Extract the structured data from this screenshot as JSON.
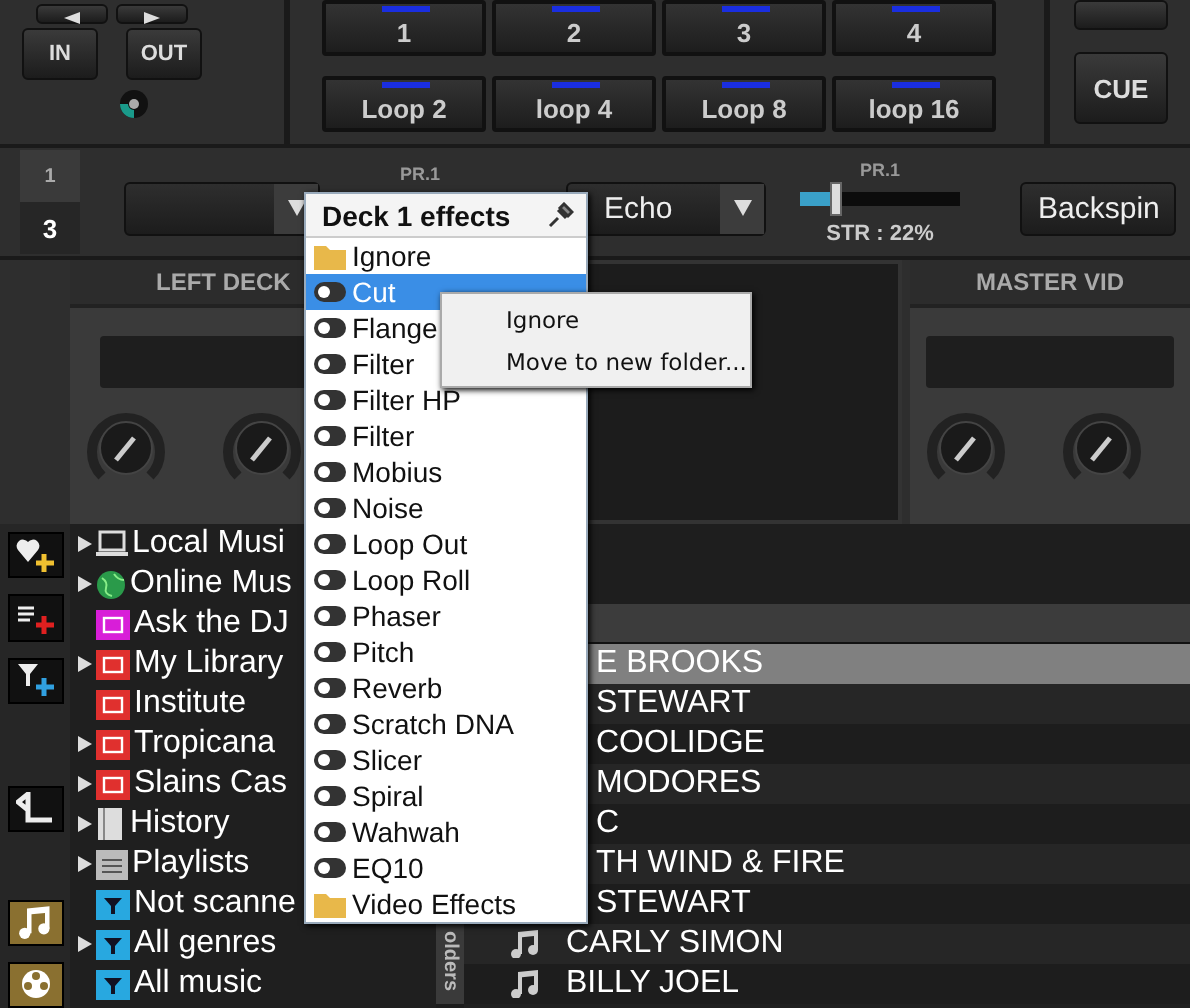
{
  "top": {
    "buttons": [
      "IN",
      "OUT"
    ],
    "pads": [
      {
        "label": "1"
      },
      {
        "label": "2"
      },
      {
        "label": "3"
      },
      {
        "label": "4"
      },
      {
        "label": "Loop 2"
      },
      {
        "label": "loop 4"
      },
      {
        "label": "Loop 8"
      },
      {
        "label": "loop 16"
      }
    ],
    "cue": "CUE"
  },
  "effects_row": {
    "decks": [
      {
        "label": "1",
        "selected": false
      },
      {
        "label": "3",
        "selected": true
      }
    ],
    "slots": [
      {
        "label": "PR.1"
      },
      {
        "label": "PR.1"
      }
    ],
    "echo": "Echo",
    "strength": {
      "level": 0.22,
      "reading": "STR : 22%"
    },
    "backspin": "Backspin"
  },
  "panels": [
    {
      "title": "LEFT DECK"
    },
    {
      "title": "MASTER VID"
    }
  ],
  "sidebar_tree": [
    {
      "label": "Local Musi",
      "kind": "computer",
      "expandable": true
    },
    {
      "label": "Online Mus",
      "kind": "globe",
      "expandable": true
    },
    {
      "label": "Ask the DJ",
      "kind": "folder",
      "color": "#d81ed8",
      "expandable": false
    },
    {
      "label": "My Library",
      "kind": "folder",
      "color": "#e0302e",
      "expandable": true
    },
    {
      "label": "Institute",
      "kind": "folder",
      "color": "#e0302e",
      "expandable": false
    },
    {
      "label": "Tropicana",
      "kind": "folder",
      "color": "#e0302e",
      "expandable": true
    },
    {
      "label": "Slains Cas",
      "kind": "folder",
      "color": "#e0302e",
      "expandable": true
    },
    {
      "label": "History",
      "kind": "history",
      "expandable": true
    },
    {
      "label": "Playlists",
      "kind": "playlist",
      "expandable": true
    },
    {
      "label": "Not scanne",
      "kind": "filter",
      "color": "#28a8e0",
      "expandable": false
    },
    {
      "label": "All genres",
      "kind": "filter",
      "color": "#28a8e0",
      "expandable": true
    },
    {
      "label": "All music",
      "kind": "filter",
      "color": "#28a8e0",
      "expandable": false
    }
  ],
  "folders_tab": "olders",
  "tracks": [
    {
      "artist": "E BROOKS",
      "selected": true,
      "note_icon": false
    },
    {
      "artist": "STEWART",
      "selected": false,
      "note_icon": false
    },
    {
      "artist": "COOLIDGE",
      "selected": false,
      "note_icon": false
    },
    {
      "artist": "MODORES",
      "selected": false,
      "note_icon": false
    },
    {
      "artist": "C",
      "selected": false,
      "note_icon": false
    },
    {
      "artist": "TH WIND & FIRE",
      "selected": false,
      "note_icon": false
    },
    {
      "artist": "STEWART",
      "selected": false,
      "note_icon": false
    },
    {
      "artist": "CARLY SIMON",
      "selected": false,
      "note_icon": true
    },
    {
      "artist": "BILLY JOEL",
      "selected": false,
      "note_icon": true
    }
  ],
  "effects_menu": {
    "title": "Deck 1 effects",
    "items": [
      {
        "label": "Ignore",
        "kind": "folder",
        "selected": false
      },
      {
        "label": "Cut",
        "kind": "effect",
        "selected": true
      },
      {
        "label": "Flange",
        "kind": "effect",
        "selected": false
      },
      {
        "label": "Filter",
        "kind": "effect",
        "selected": false
      },
      {
        "label": "Filter HP",
        "kind": "effect",
        "selected": false
      },
      {
        "label": "Filter",
        "kind": "effect",
        "selected": false
      },
      {
        "label": "Mobius",
        "kind": "effect",
        "selected": false
      },
      {
        "label": "Noise",
        "kind": "effect",
        "selected": false
      },
      {
        "label": "Loop Out",
        "kind": "effect",
        "selected": false
      },
      {
        "label": "Loop Roll",
        "kind": "effect",
        "selected": false
      },
      {
        "label": "Phaser",
        "kind": "effect",
        "selected": false
      },
      {
        "label": "Pitch",
        "kind": "effect",
        "selected": false
      },
      {
        "label": "Reverb",
        "kind": "effect",
        "selected": false
      },
      {
        "label": "Scratch DNA",
        "kind": "effect",
        "selected": false
      },
      {
        "label": "Slicer",
        "kind": "effect",
        "selected": false
      },
      {
        "label": "Spiral",
        "kind": "effect",
        "selected": false
      },
      {
        "label": "Wahwah",
        "kind": "effect",
        "selected": false
      },
      {
        "label": "EQ10",
        "kind": "effect",
        "selected": false
      },
      {
        "label": "Video Effects",
        "kind": "folder",
        "selected": false
      }
    ]
  },
  "context_menu": [
    "Ignore",
    "Move to new folder..."
  ]
}
